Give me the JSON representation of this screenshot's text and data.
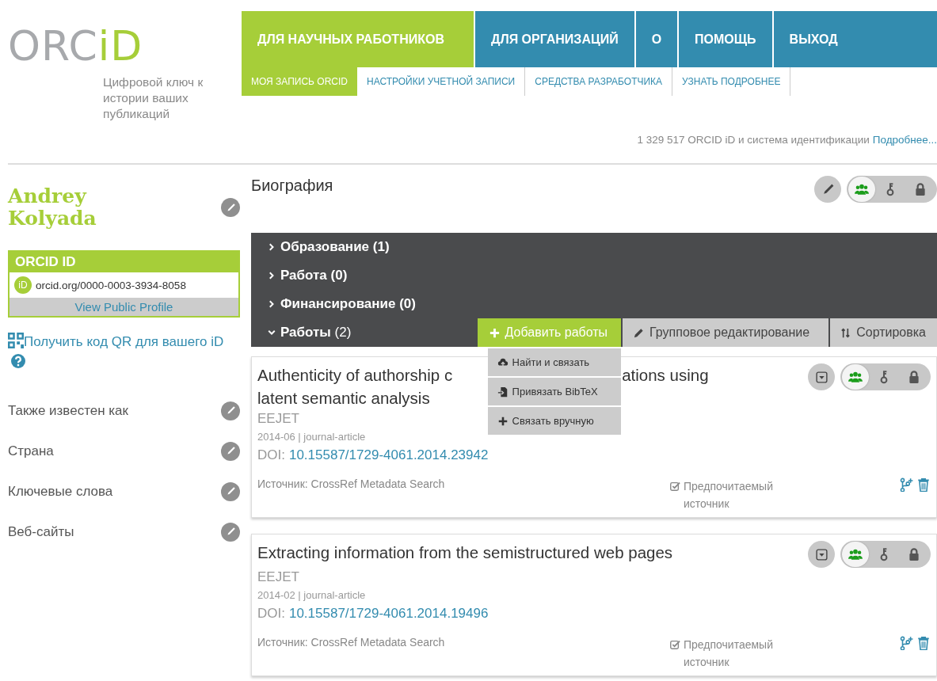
{
  "header": {
    "logo": [
      "ORC",
      "iD"
    ],
    "tagline": "Цифровой ключ к истории ваших публикаций",
    "stats": "1 329 517 ORCID iD и система идентификации",
    "stats_link": "Подробнее..."
  },
  "main_nav": [
    {
      "label": "ДЛЯ НАУЧНЫХ РАБОТНИКОВ",
      "selected": true
    },
    {
      "label": "ДЛЯ ОРГАНИЗАЦИЙ",
      "selected": false
    },
    {
      "label": "О",
      "selected": false
    },
    {
      "label": "ПОМОЩЬ",
      "selected": false
    },
    {
      "label": "ВЫХОД",
      "selected": false
    }
  ],
  "sub_nav": [
    {
      "label": "МОЯ ЗАПИСЬ ORCID",
      "selected": true
    },
    {
      "label": "НАСТРОЙКИ УЧЕТНОЙ ЗАПИСИ",
      "selected": false
    },
    {
      "label": "СРЕДСТВА РАЗРАБОТЧИКА",
      "selected": false
    },
    {
      "label": "УЗНАТЬ ПОДРОБНЕЕ",
      "selected": false
    }
  ],
  "profile": {
    "name": "Andrey Kolyada",
    "orcid_box": {
      "heading": "ORCID ID",
      "badge": "iD",
      "url": "orcid.org/0000-0003-3934-8058",
      "public_profile": "View Public Profile"
    },
    "qr_link": "Получить код QR для вашего iD",
    "fields": [
      {
        "label": "Также известен как"
      },
      {
        "label": "Страна"
      },
      {
        "label": "Ключевые слова"
      },
      {
        "label": "Веб-сайты"
      }
    ]
  },
  "biography": {
    "title": "Биография",
    "privacy": [
      {
        "kind": "everyone",
        "selected": true
      },
      {
        "kind": "trusted",
        "selected": false
      },
      {
        "kind": "private",
        "selected": false
      }
    ]
  },
  "sections": [
    {
      "title": "Образование",
      "count": "(1)",
      "expanded": false
    },
    {
      "title": "Работа",
      "count": "(0)",
      "expanded": false
    },
    {
      "title": "Финансирование",
      "count": "(0)",
      "expanded": false
    },
    {
      "title": "Работы",
      "count": "(2)",
      "expanded": true
    }
  ],
  "work_actions": [
    {
      "kind": "add",
      "label": "Добавить работы",
      "selected": true
    },
    {
      "kind": "bulk-edit",
      "label": "Групповое редактирование",
      "selected": false
    },
    {
      "kind": "sort",
      "label": "Сортировка",
      "selected": false
    }
  ],
  "add_menu": [
    {
      "kind": "search",
      "label": "Найти и связать"
    },
    {
      "kind": "bibtex",
      "label": "Привязать BibTeX"
    },
    {
      "kind": "manual",
      "label": "Связать вручную"
    }
  ],
  "works": [
    {
      "title_lines": [
        [
          "Authenticity of authorship c",
          "ations using"
        ],
        [
          "latent semantic analysis"
        ]
      ],
      "journal": "EEJET",
      "meta": "2014-06 | journal-article",
      "doi_label": "DOI:",
      "doi": "10.15587/1729-4061.2014.23942",
      "source": "Источник: CrossRef Metadata Search",
      "preferred": true,
      "preferred_label": "Предпочитаемый источник",
      "privacy": [
        {
          "kind": "everyone",
          "selected": true
        },
        {
          "kind": "trusted",
          "selected": false
        },
        {
          "kind": "private",
          "selected": false
        }
      ]
    },
    {
      "title_lines": [
        [
          "Extracting information from the semistructured web pages"
        ]
      ],
      "journal": "EEJET",
      "meta": "2014-02 | journal-article",
      "doi_label": "DOI:",
      "doi": "10.15587/1729-4061.2014.19496",
      "source": "Источник: CrossRef Metadata Search",
      "preferred": true,
      "preferred_label": "Предпочитаемый источник",
      "privacy": [
        {
          "kind": "everyone",
          "selected": true
        },
        {
          "kind": "trusted",
          "selected": false
        },
        {
          "kind": "private",
          "selected": false
        }
      ]
    }
  ]
}
